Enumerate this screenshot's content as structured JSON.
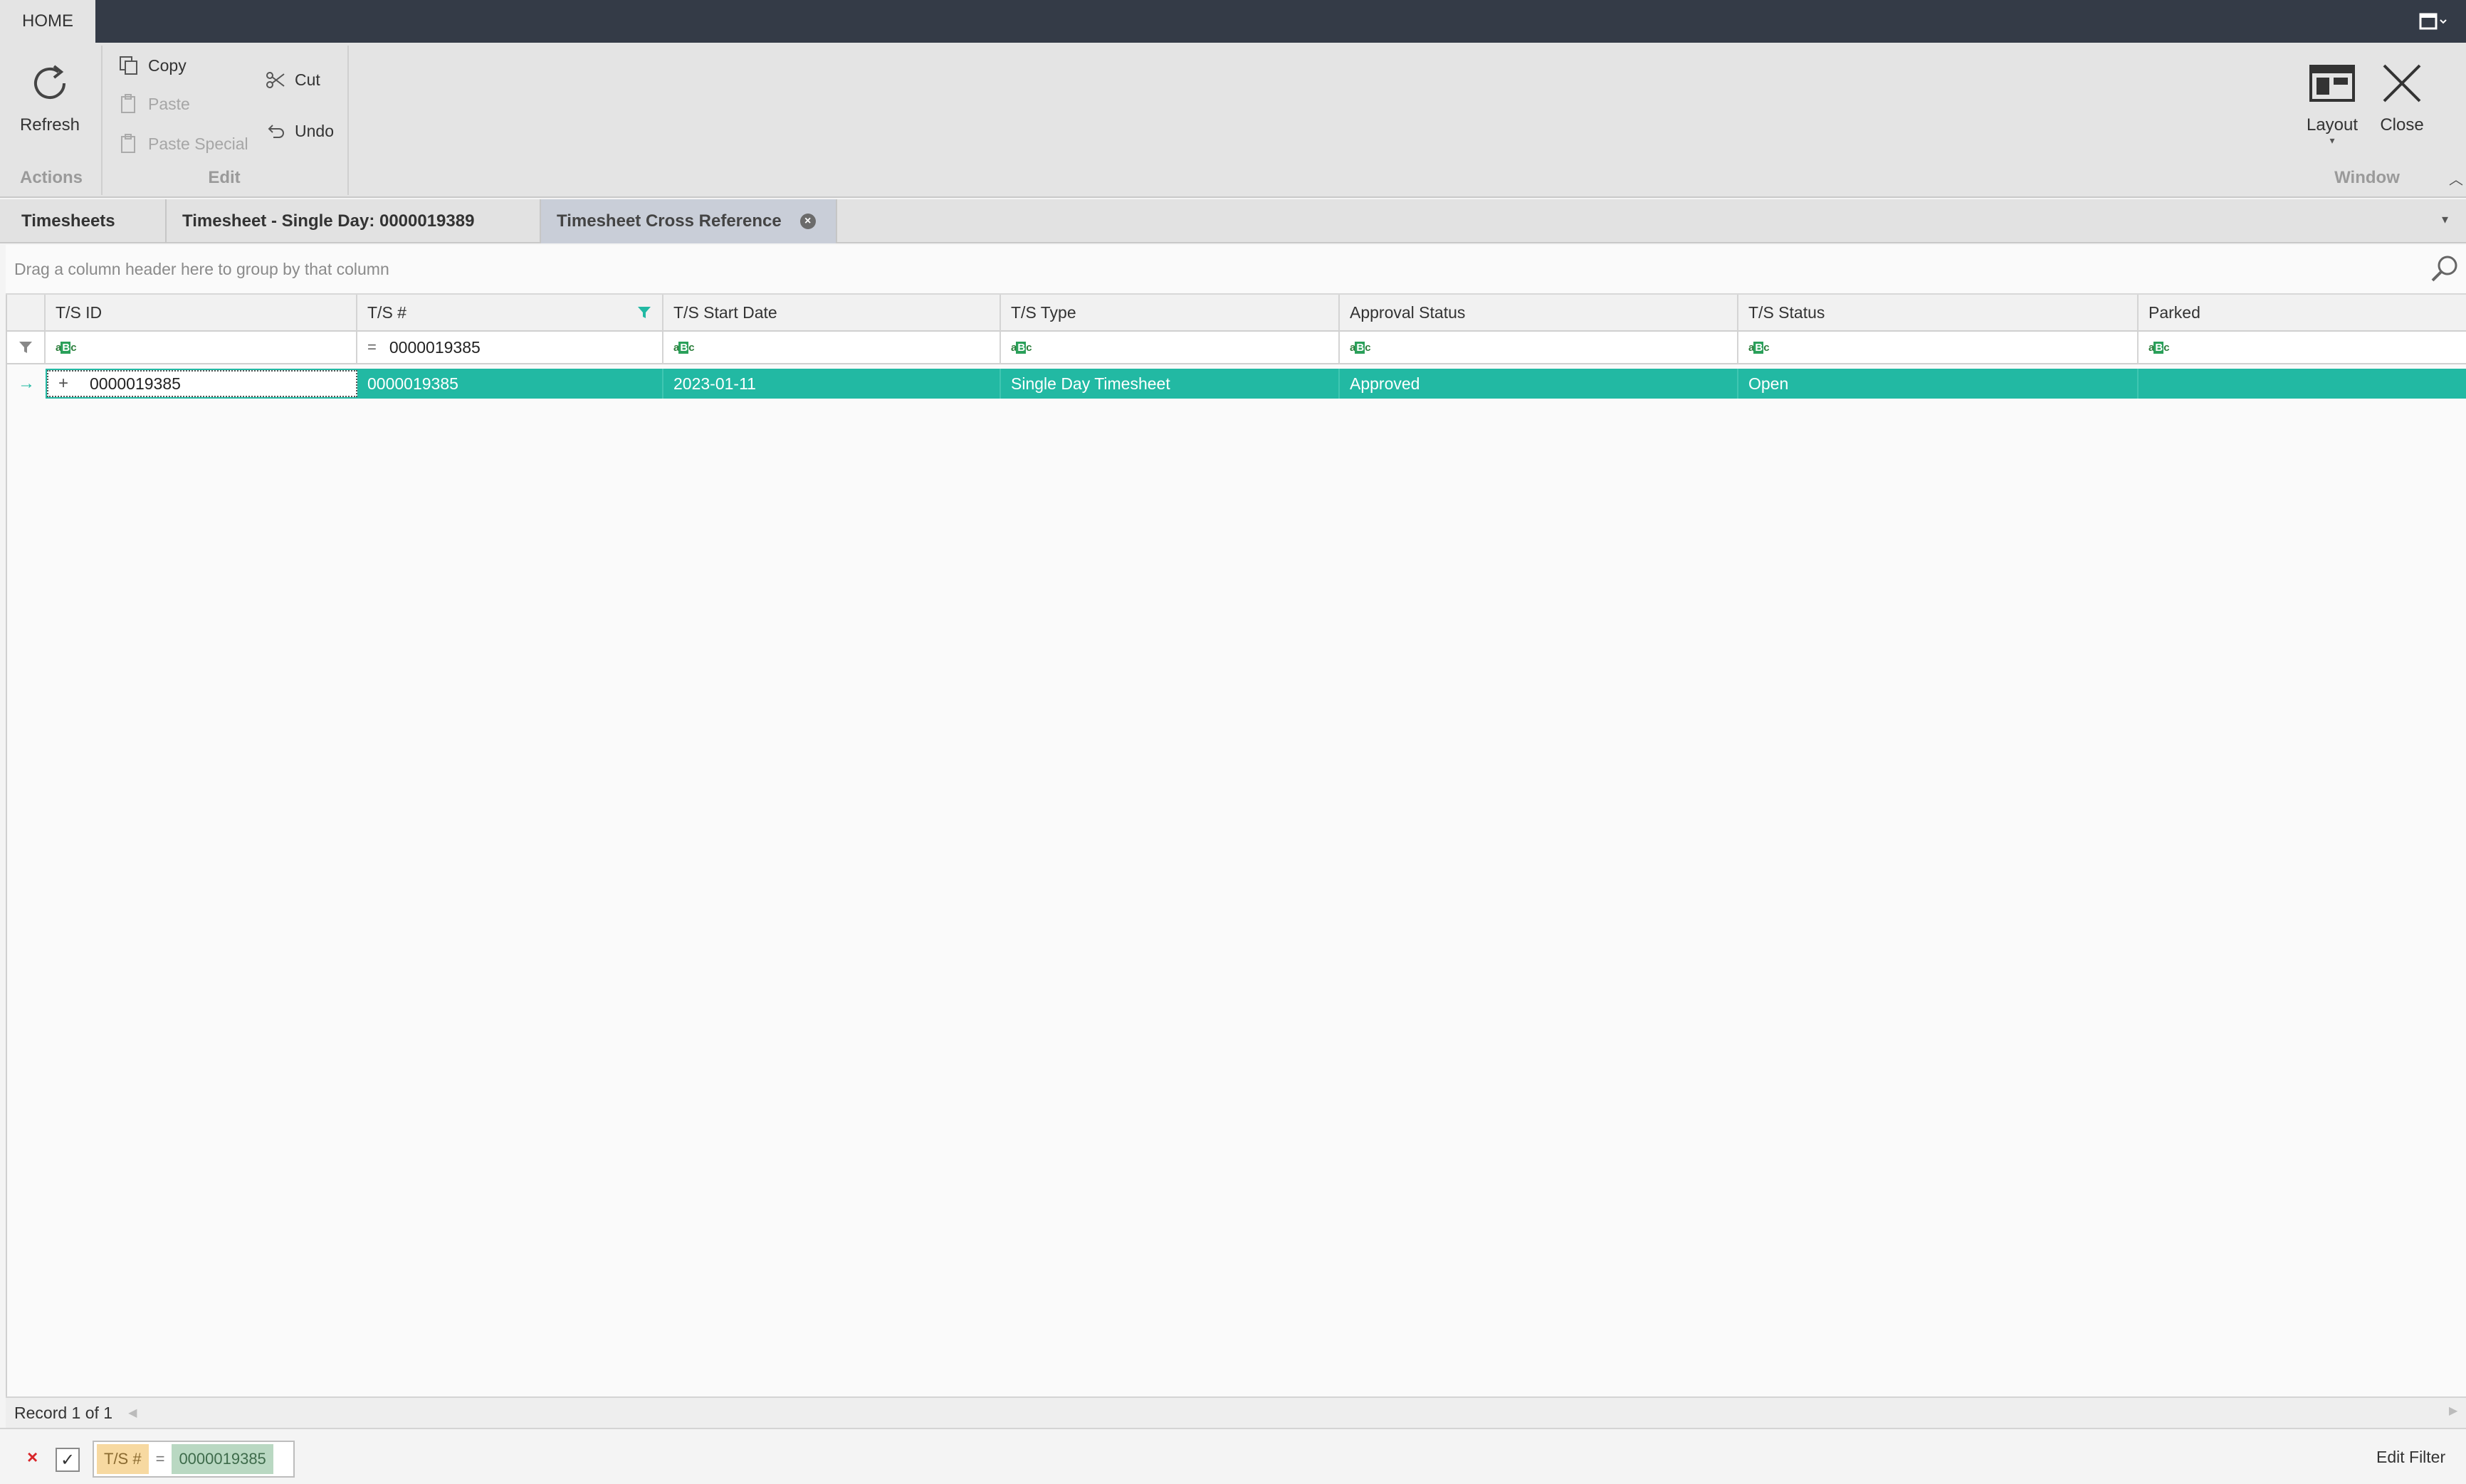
{
  "titlebar": {
    "home_tab": "HOME"
  },
  "ribbon": {
    "refresh_label": "Refresh",
    "actions_group": "Actions",
    "copy_label": "Copy",
    "paste_label": "Paste",
    "paste_special_label": "Paste Special",
    "cut_label": "Cut",
    "undo_label": "Undo",
    "edit_group": "Edit",
    "layout_label": "Layout",
    "close_label": "Close",
    "window_group": "Window"
  },
  "tabs": [
    {
      "label": "Timesheets"
    },
    {
      "label": "Timesheet - Single Day: 0000019389"
    },
    {
      "label": "Timesheet Cross Reference"
    }
  ],
  "grid": {
    "group_panel_text": "Drag a column header here to group by that column",
    "columns": [
      "T/S ID",
      "T/S #",
      "T/S Start Date",
      "T/S Type",
      "Approval Status",
      "T/S Status",
      "Parked"
    ],
    "filter_value": "0000019385",
    "rows": [
      {
        "ts_id": "0000019385",
        "ts_num": "0000019385",
        "start_date": "2023-01-11",
        "type": "Single Day Timesheet",
        "approval": "Approved",
        "status": "Open",
        "parked": ""
      }
    ]
  },
  "status": {
    "record_text": "Record 1 of 1"
  },
  "filter": {
    "field": "T/S #",
    "operator": "=",
    "value": "0000019385",
    "edit_label": "Edit Filter"
  },
  "colors": {
    "selection": "#22b9a3",
    "titlebar": "#343b47",
    "filter_field_bg": "#f7d9a1",
    "filter_value_bg": "#b9d8c2"
  }
}
